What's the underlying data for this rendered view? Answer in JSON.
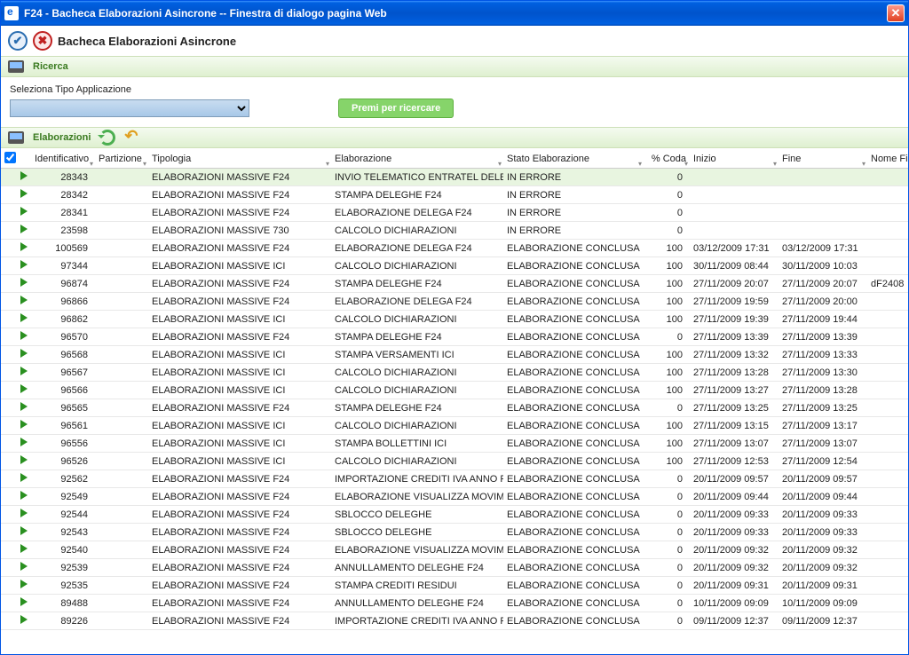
{
  "window": {
    "title": "F24 - Bacheca Elaborazioni Asincrone -- Finestra di dialogo pagina Web"
  },
  "page": {
    "title": "Bacheca Elaborazioni Asincrone"
  },
  "search": {
    "section": "Ricerca",
    "label": "Seleziona Tipo Applicazione",
    "button": "Premi per ricercare"
  },
  "elab": {
    "section": "Elaborazioni"
  },
  "columns": {
    "id": "Identificativo",
    "part": "Partizione",
    "tip": "Tipologia",
    "elab": "Elaborazione",
    "stato": "Stato Elaborazione",
    "coda": "% Coda",
    "inizio": "Inizio",
    "fine": "Fine",
    "nome": "Nome Fi"
  },
  "rows": [
    {
      "id": "28343",
      "part": "",
      "tip": "ELABORAZIONI MASSIVE F24",
      "elab": "INVIO TELEMATICO ENTRATEL DELEGA I",
      "stato": "IN ERRORE",
      "coda": "0",
      "inizio": "",
      "fine": "",
      "nome": ""
    },
    {
      "id": "28342",
      "part": "",
      "tip": "ELABORAZIONI MASSIVE F24",
      "elab": "STAMPA DELEGHE  F24",
      "stato": "IN ERRORE",
      "coda": "0",
      "inizio": "",
      "fine": "",
      "nome": ""
    },
    {
      "id": "28341",
      "part": "",
      "tip": "ELABORAZIONI MASSIVE F24",
      "elab": "ELABORAZIONE DELEGA F24",
      "stato": "IN ERRORE",
      "coda": "0",
      "inizio": "",
      "fine": "",
      "nome": ""
    },
    {
      "id": "23598",
      "part": "",
      "tip": "ELABORAZIONI MASSIVE 730",
      "elab": "CALCOLO DICHIARAZIONI",
      "stato": "IN ERRORE",
      "coda": "0",
      "inizio": "",
      "fine": "",
      "nome": ""
    },
    {
      "id": "100569",
      "part": "",
      "tip": "ELABORAZIONI MASSIVE F24",
      "elab": "ELABORAZIONE DELEGA F24",
      "stato": "ELABORAZIONE CONCLUSA",
      "coda": "100",
      "inizio": "03/12/2009 17:31",
      "fine": "03/12/2009 17:31",
      "nome": ""
    },
    {
      "id": "97344",
      "part": "",
      "tip": "ELABORAZIONI MASSIVE ICI",
      "elab": "CALCOLO DICHIARAZIONI",
      "stato": "ELABORAZIONE CONCLUSA",
      "coda": "100",
      "inizio": "30/11/2009 08:44",
      "fine": "30/11/2009 10:03",
      "nome": ""
    },
    {
      "id": "96874",
      "part": "",
      "tip": "ELABORAZIONI MASSIVE F24",
      "elab": "STAMPA DELEGHE  F24",
      "stato": "ELABORAZIONE CONCLUSA",
      "coda": "100",
      "inizio": "27/11/2009 20:07",
      "fine": "27/11/2009 20:07",
      "nome": "dF2408"
    },
    {
      "id": "96866",
      "part": "",
      "tip": "ELABORAZIONI MASSIVE F24",
      "elab": "ELABORAZIONE DELEGA F24",
      "stato": "ELABORAZIONE CONCLUSA",
      "coda": "100",
      "inizio": "27/11/2009 19:59",
      "fine": "27/11/2009 20:00",
      "nome": ""
    },
    {
      "id": "96862",
      "part": "",
      "tip": "ELABORAZIONI MASSIVE ICI",
      "elab": "CALCOLO DICHIARAZIONI",
      "stato": "ELABORAZIONE CONCLUSA",
      "coda": "100",
      "inizio": "27/11/2009 19:39",
      "fine": "27/11/2009 19:44",
      "nome": ""
    },
    {
      "id": "96570",
      "part": "",
      "tip": "ELABORAZIONI MASSIVE F24",
      "elab": "STAMPA DELEGHE  F24",
      "stato": "ELABORAZIONE CONCLUSA",
      "coda": "0",
      "inizio": "27/11/2009 13:39",
      "fine": "27/11/2009 13:39",
      "nome": ""
    },
    {
      "id": "96568",
      "part": "",
      "tip": "ELABORAZIONI MASSIVE ICI",
      "elab": "STAMPA VERSAMENTI ICI",
      "stato": "ELABORAZIONE CONCLUSA",
      "coda": "100",
      "inizio": "27/11/2009 13:32",
      "fine": "27/11/2009 13:33",
      "nome": ""
    },
    {
      "id": "96567",
      "part": "",
      "tip": "ELABORAZIONI MASSIVE ICI",
      "elab": "CALCOLO DICHIARAZIONI",
      "stato": "ELABORAZIONE CONCLUSA",
      "coda": "100",
      "inizio": "27/11/2009 13:28",
      "fine": "27/11/2009 13:30",
      "nome": ""
    },
    {
      "id": "96566",
      "part": "",
      "tip": "ELABORAZIONI MASSIVE ICI",
      "elab": "CALCOLO DICHIARAZIONI",
      "stato": "ELABORAZIONE CONCLUSA",
      "coda": "100",
      "inizio": "27/11/2009 13:27",
      "fine": "27/11/2009 13:28",
      "nome": ""
    },
    {
      "id": "96565",
      "part": "",
      "tip": "ELABORAZIONI MASSIVE F24",
      "elab": "STAMPA DELEGHE  F24",
      "stato": "ELABORAZIONE CONCLUSA",
      "coda": "0",
      "inizio": "27/11/2009 13:25",
      "fine": "27/11/2009 13:25",
      "nome": ""
    },
    {
      "id": "96561",
      "part": "",
      "tip": "ELABORAZIONI MASSIVE ICI",
      "elab": "CALCOLO DICHIARAZIONI",
      "stato": "ELABORAZIONE CONCLUSA",
      "coda": "100",
      "inizio": "27/11/2009 13:15",
      "fine": "27/11/2009 13:17",
      "nome": ""
    },
    {
      "id": "96556",
      "part": "",
      "tip": "ELABORAZIONI MASSIVE ICI",
      "elab": "STAMPA BOLLETTINI ICI",
      "stato": "ELABORAZIONE CONCLUSA",
      "coda": "100",
      "inizio": "27/11/2009 13:07",
      "fine": "27/11/2009 13:07",
      "nome": ""
    },
    {
      "id": "96526",
      "part": "",
      "tip": "ELABORAZIONI MASSIVE ICI",
      "elab": "CALCOLO DICHIARAZIONI",
      "stato": "ELABORAZIONE CONCLUSA",
      "coda": "100",
      "inizio": "27/11/2009 12:53",
      "fine": "27/11/2009 12:54",
      "nome": ""
    },
    {
      "id": "92562",
      "part": "",
      "tip": "ELABORAZIONI MASSIVE F24",
      "elab": "IMPORTAZIONE CREDITI IVA ANNO PRE",
      "stato": "ELABORAZIONE CONCLUSA",
      "coda": "0",
      "inizio": "20/11/2009 09:57",
      "fine": "20/11/2009 09:57",
      "nome": ""
    },
    {
      "id": "92549",
      "part": "",
      "tip": "ELABORAZIONI MASSIVE F24",
      "elab": "ELABORAZIONE VISUALIZZA MOVIMENT",
      "stato": "ELABORAZIONE CONCLUSA",
      "coda": "0",
      "inizio": "20/11/2009 09:44",
      "fine": "20/11/2009 09:44",
      "nome": ""
    },
    {
      "id": "92544",
      "part": "",
      "tip": "ELABORAZIONI MASSIVE F24",
      "elab": "SBLOCCO DELEGHE",
      "stato": "ELABORAZIONE CONCLUSA",
      "coda": "0",
      "inizio": "20/11/2009 09:33",
      "fine": "20/11/2009 09:33",
      "nome": ""
    },
    {
      "id": "92543",
      "part": "",
      "tip": "ELABORAZIONI MASSIVE F24",
      "elab": "SBLOCCO DELEGHE",
      "stato": "ELABORAZIONE CONCLUSA",
      "coda": "0",
      "inizio": "20/11/2009 09:33",
      "fine": "20/11/2009 09:33",
      "nome": ""
    },
    {
      "id": "92540",
      "part": "",
      "tip": "ELABORAZIONI MASSIVE F24",
      "elab": "ELABORAZIONE VISUALIZZA MOVIMENT",
      "stato": "ELABORAZIONE CONCLUSA",
      "coda": "0",
      "inizio": "20/11/2009 09:32",
      "fine": "20/11/2009 09:32",
      "nome": ""
    },
    {
      "id": "92539",
      "part": "",
      "tip": "ELABORAZIONI MASSIVE F24",
      "elab": "ANNULLAMENTO DELEGHE F24",
      "stato": "ELABORAZIONE CONCLUSA",
      "coda": "0",
      "inizio": "20/11/2009 09:32",
      "fine": "20/11/2009 09:32",
      "nome": ""
    },
    {
      "id": "92535",
      "part": "",
      "tip": "ELABORAZIONI MASSIVE F24",
      "elab": "STAMPA CREDITI RESIDUI",
      "stato": "ELABORAZIONE CONCLUSA",
      "coda": "0",
      "inizio": "20/11/2009 09:31",
      "fine": "20/11/2009 09:31",
      "nome": ""
    },
    {
      "id": "89488",
      "part": "",
      "tip": "ELABORAZIONI MASSIVE F24",
      "elab": "ANNULLAMENTO DELEGHE F24",
      "stato": "ELABORAZIONE CONCLUSA",
      "coda": "0",
      "inizio": "10/11/2009 09:09",
      "fine": "10/11/2009 09:09",
      "nome": ""
    },
    {
      "id": "89226",
      "part": "",
      "tip": "ELABORAZIONI MASSIVE F24",
      "elab": "IMPORTAZIONE CREDITI IVA ANNO PRE",
      "stato": "ELABORAZIONE CONCLUSA",
      "coda": "0",
      "inizio": "09/11/2009 12:37",
      "fine": "09/11/2009 12:37",
      "nome": ""
    }
  ]
}
